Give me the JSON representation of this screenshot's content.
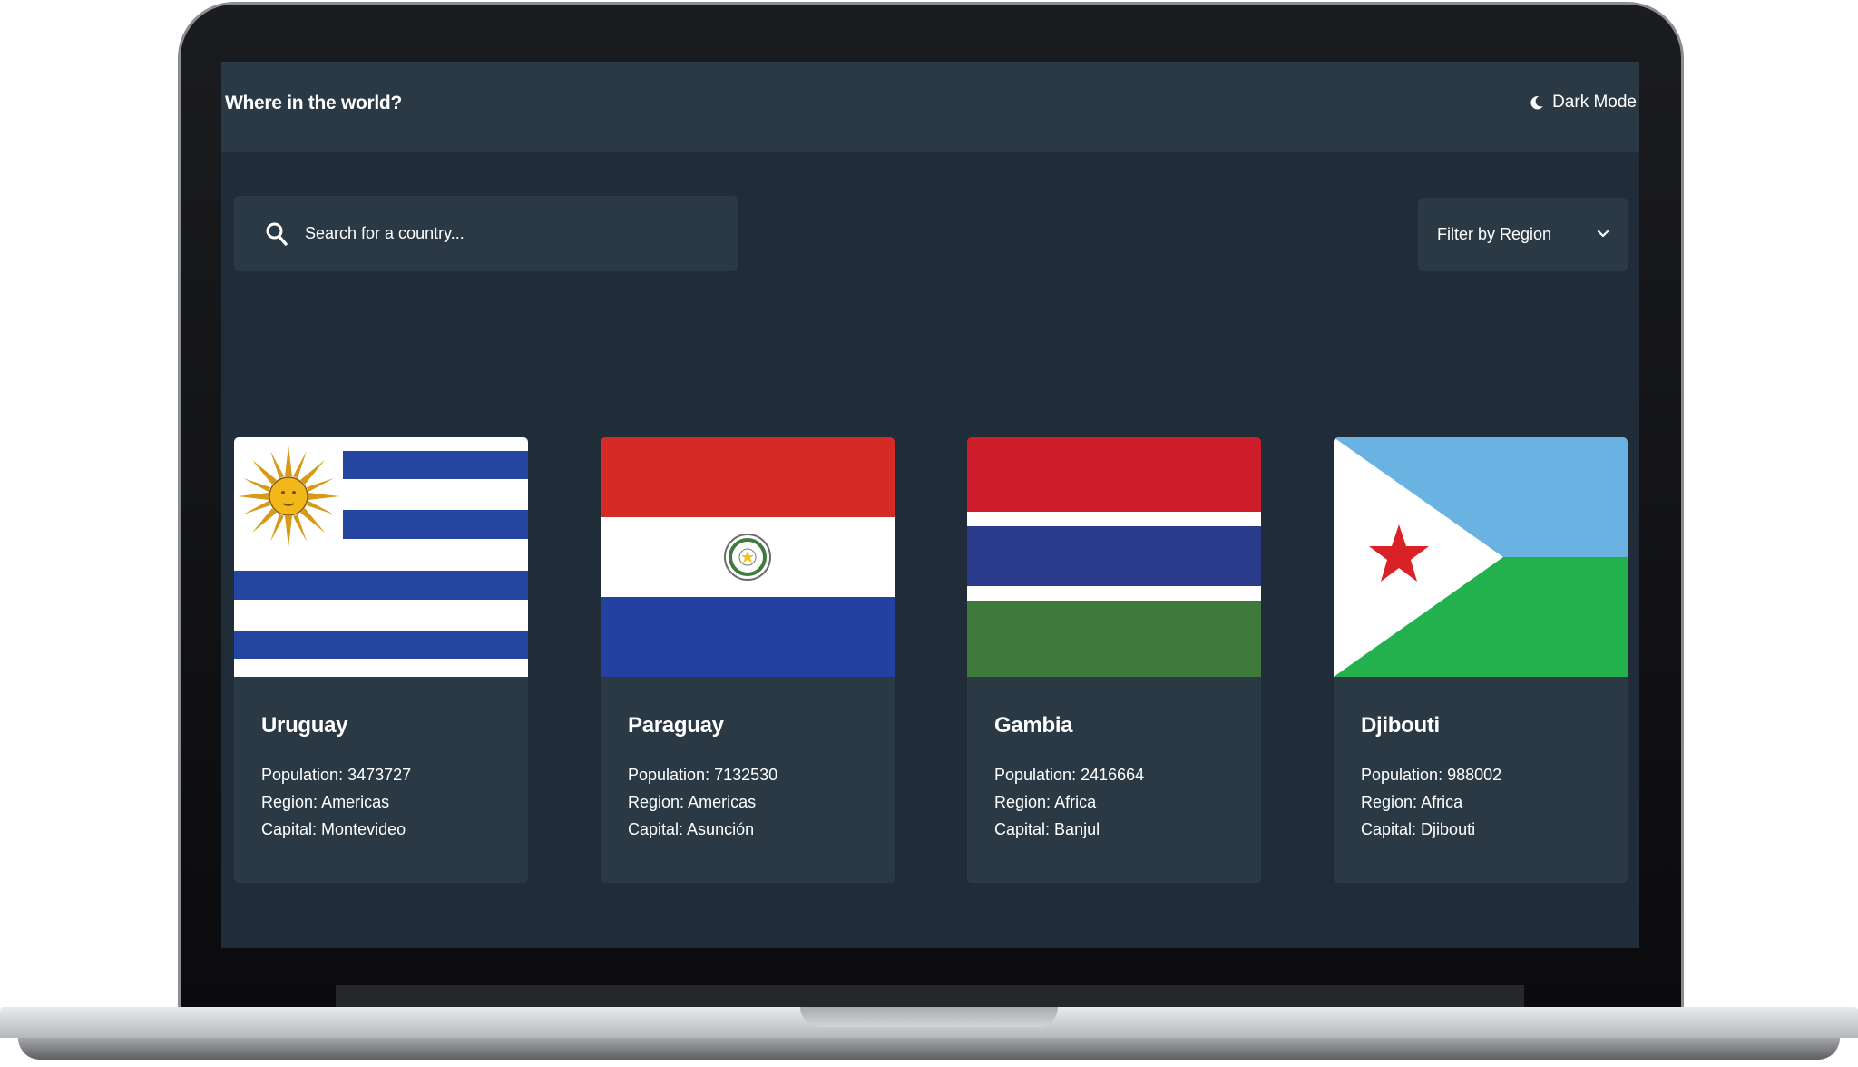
{
  "header": {
    "title": "Where in the world?",
    "theme_toggle_label": "Dark Mode"
  },
  "search": {
    "placeholder": "Search for a country..."
  },
  "filter": {
    "label": "Filter by Region"
  },
  "labels": {
    "population": "Population:",
    "region": "Region:",
    "capital": "Capital:"
  },
  "countries": [
    {
      "name": "Uruguay",
      "population": "3473727",
      "region": "Americas",
      "capital": "Montevideo"
    },
    {
      "name": "Paraguay",
      "population": "7132530",
      "region": "Americas",
      "capital": "Asunción"
    },
    {
      "name": "Gambia",
      "population": "2416664",
      "region": "Africa",
      "capital": "Banjul"
    },
    {
      "name": "Djibouti",
      "population": "988002",
      "region": "Africa",
      "capital": "Djibouti"
    }
  ],
  "colors": {
    "background": "#202c37",
    "elements": "#2b3945",
    "text": "#ffffff"
  }
}
